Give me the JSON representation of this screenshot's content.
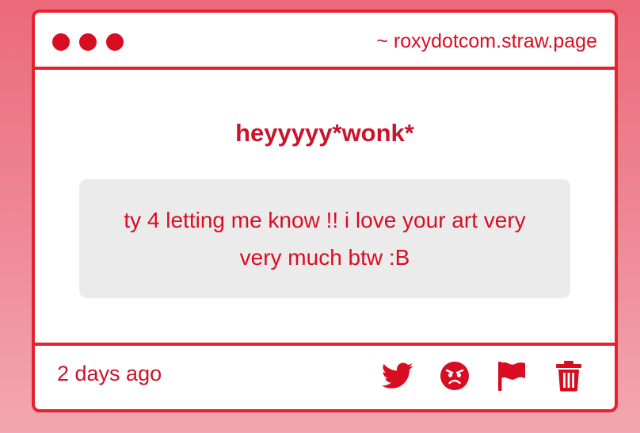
{
  "window": {
    "url": "~ roxydotcom.straw.page"
  },
  "post": {
    "author": "heyyyyy*wonk*",
    "message": "ty 4 letting me know !! i love your art very very much btw :B",
    "timestamp": "2 days ago"
  },
  "actions": [
    {
      "icon": "twitter-icon"
    },
    {
      "icon": "angry-face-icon"
    },
    {
      "icon": "flag-icon"
    },
    {
      "icon": "trash-icon"
    }
  ],
  "colors": {
    "accent": "#d90d22",
    "border": "#e4232f",
    "message_bg": "#ecebec",
    "background_top": "#ec6a7a",
    "background_bottom": "#f4a7b0"
  }
}
